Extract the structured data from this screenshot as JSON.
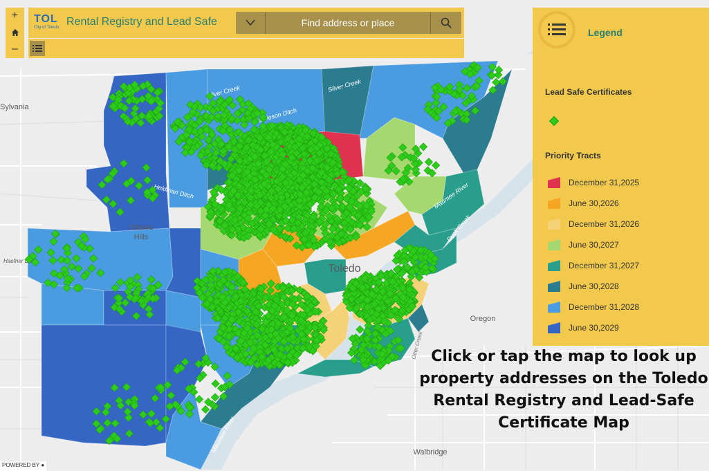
{
  "app": {
    "logo_text": "TOL",
    "logo_subtext": "City of Toledo",
    "title": "Rental Registry and Lead Safe"
  },
  "search": {
    "placeholder": "Find address or place",
    "dropdown_icon": "chevron-down-icon",
    "button_icon": "search-icon"
  },
  "toolbar": {
    "list_icon": "list-icon"
  },
  "zoom": {
    "in_label": "+",
    "home_icon": "home-icon",
    "out_label": "–"
  },
  "legend": {
    "title": "Legend",
    "lead_safe_heading": "Lead Safe Certificates",
    "lead_safe_color": "#2ecc1a",
    "priority_heading": "Priority Tracts",
    "items": [
      {
        "label": "December 31,2025",
        "color": "#e0334f"
      },
      {
        "label": "June 30,2026",
        "color": "#f5a623"
      },
      {
        "label": "December 31,2026",
        "color": "#f5d27a"
      },
      {
        "label": "June 30,2027",
        "color": "#a5d86e"
      },
      {
        "label": "December 31,2027",
        "color": "#2a9e8c"
      },
      {
        "label": "June 30,2028",
        "color": "#2b7c8f"
      },
      {
        "label": "December 31,2028",
        "color": "#4a9be0"
      },
      {
        "label": "June 30,2029",
        "color": "#3566c4"
      }
    ]
  },
  "map": {
    "places": [
      "Sylvania",
      "Ottawa Hills",
      "Toledo",
      "Oregon",
      "Walbridge"
    ],
    "water_labels": [
      "Silver Creek",
      "Silver Creek",
      "Jamieson Ditch",
      "Heldman Ditch",
      "Haefner Ditch",
      "Maumee River",
      "Maumee River",
      "Otter Creek",
      "Duck Creek"
    ]
  },
  "cta_text": "Click or tap the map to look up property addresses on the Toledo Rental Registry and Lead-Safe Certificate Map",
  "powered_by": "POWERED BY"
}
